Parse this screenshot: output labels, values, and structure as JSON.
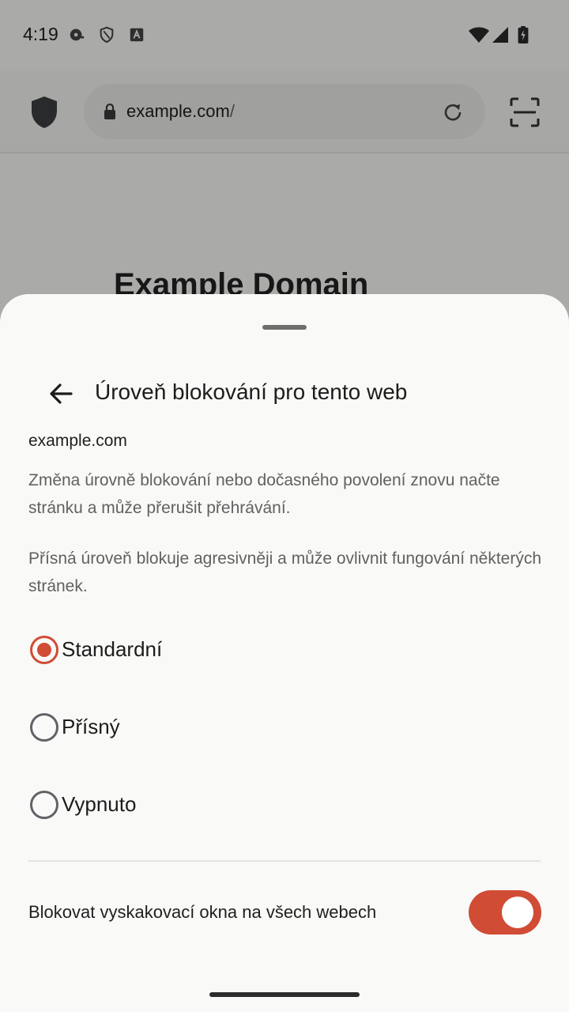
{
  "status_bar": {
    "time": "4:19"
  },
  "browser": {
    "url_domain": "example.com",
    "url_path": "/",
    "page_heading": "Example Domain"
  },
  "sheet": {
    "title": "Úroveň blokování pro tento web",
    "domain": "example.com",
    "description_1": "Změna úrovně blokování nebo dočasného povolení znovu načte stránku a může přerušit přehrávání.",
    "description_2": "Přísná úroveň blokuje agresivněji a může ovlivnit fungování některých stránek.",
    "options": [
      {
        "label": "Standardní",
        "checked": true
      },
      {
        "label": "Přísný",
        "checked": false
      },
      {
        "label": "Vypnuto",
        "checked": false
      }
    ],
    "popup_toggle": {
      "label": "Blokovat vyskakovací okna na všech webech",
      "on": true
    }
  },
  "colors": {
    "accent": "#d14c35",
    "scrim": "rgba(0,0,0,0.32)",
    "sheet_bg": "#f9f9f7"
  }
}
